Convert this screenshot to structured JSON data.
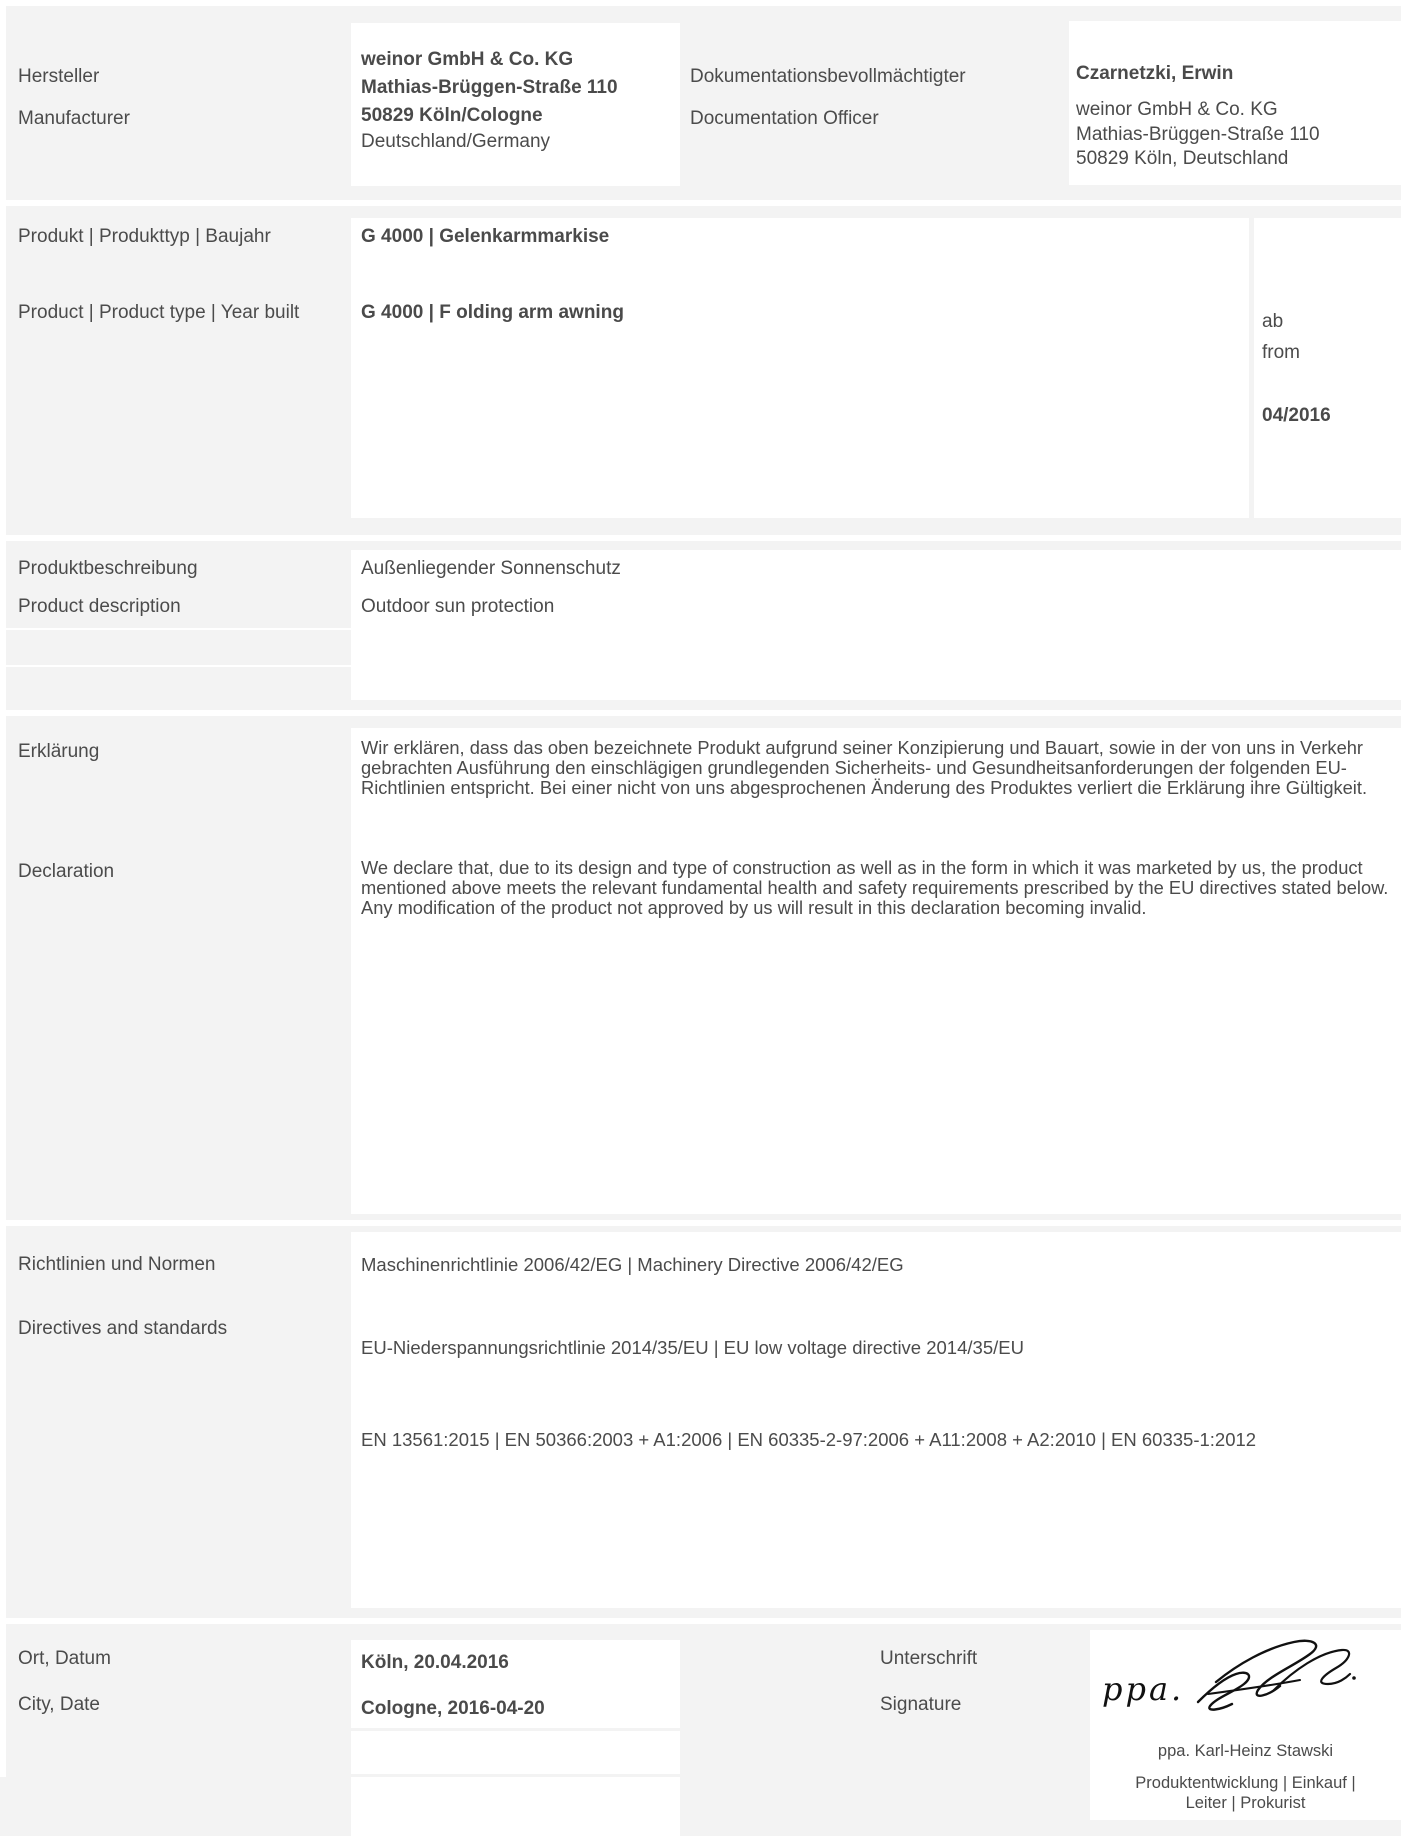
{
  "manufacturer": {
    "label_de": "Hersteller",
    "label_en": "Manufacturer",
    "address": [
      "weinor GmbH & Co. KG",
      "Mathias-Brüggen-Straße 110",
      "50829 Köln/Cologne",
      "Deutschland/Germany"
    ]
  },
  "documentation_officer": {
    "label_de": "Dokumentationsbevollmächtigter",
    "label_en": "Documentation Officer",
    "name": "Czarnetzki, Erwin",
    "address": [
      "weinor GmbH & Co. KG",
      "Mathias-Brüggen-Straße 110",
      "50829 Köln, Deutschland"
    ]
  },
  "product": {
    "label_de": "Produkt | Produkttyp | Baujahr",
    "label_en": "Product | Product type | Year built",
    "name_de": "G 4000  |  Gelenkarmmarkise",
    "name_en": "G 4000 | F olding arm awning",
    "year_ab": "ab",
    "year_from": "from",
    "year": "04/2016"
  },
  "description": {
    "label_de": "Produktbeschreibung",
    "label_en": "Product description",
    "value_de": "Außenliegender Sonnenschutz",
    "value_en": "Outdoor sun protection"
  },
  "declaration": {
    "label_de": "Erklärung",
    "label_en": "Declaration",
    "text_de": "Wir erklären, dass das oben bezeichnete Produkt aufgrund seiner Konzipierung und Bauart, sowie in der von uns in Verkehr gebrachten Ausführung den einschlägigen grundlegenden Sicherheits- und Gesundheitsanforderungen der folgenden EU-Richtlinien entspricht. Bei einer nicht von uns abgesprochenen Änderung des Produktes verliert die Erklärung ihre Gültigkeit.",
    "text_en": "We declare that, due to its design and type of construction as well as in the form in which it was marketed by us, the product mentioned above meets the relevant fundamental health and safety requirements prescribed by the EU directives stated below. Any modification of the product not approved by us will result in this declaration becoming invalid."
  },
  "directives": {
    "label_de": "Richtlinien und Normen",
    "label_en": "Directives and standards",
    "items": [
      "Maschinenrichtlinie 2006/42/EG   |   Machinery Directive 2006/42/EG",
      "EU-Niederspannungsrichtlinie 2014/35/EU   |   EU low voltage directive 2014/35/EU",
      "EN 13561:2015   |   EN 50366:2003 + A1:2006   |   EN 60335-2-97:2006 + A11:2008 + A2:2010   |  EN 60335-1:2012"
    ]
  },
  "place_date": {
    "label_de": "Ort, Datum",
    "label_en": "City, Date",
    "value_de": "Köln, 20.04.2016",
    "value_en": "Cologne, 2016-04-20"
  },
  "signature": {
    "label_de": "Unterschrift",
    "label_en": "Signature",
    "handwriting": "ppa.",
    "signer": "ppa. Karl-Heinz Stawski",
    "role": "Produktentwicklung | Einkauf | Leiter | Prokurist"
  }
}
